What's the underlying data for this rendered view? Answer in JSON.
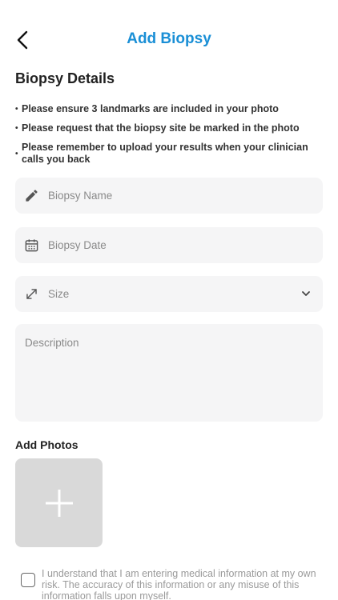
{
  "header": {
    "title": "Add Biopsy",
    "accent_color": "#1a8fd6"
  },
  "section": {
    "title": "Biopsy Details"
  },
  "instructions": [
    "Please ensure 3 landmarks are included in your photo",
    "Please request that the biopsy site be marked in the photo",
    "Please remember to upload your results when your clinician calls you back"
  ],
  "form": {
    "name_placeholder": "Biopsy Name",
    "date_placeholder": "Biopsy Date",
    "size_placeholder": "Size",
    "description_placeholder": "Description",
    "field_background": "#f5f5f6"
  },
  "photos": {
    "title": "Add Photos"
  },
  "consent": {
    "text": "I understand that I am entering medical information at my own risk. The accuracy of this information or any misuse of this information falls upon myself.",
    "checked": false
  },
  "icons": {
    "back": "chevron-left-icon",
    "name": "pencil-icon",
    "date": "calendar-icon",
    "size": "resize-icon",
    "dropdown": "chevron-down-icon",
    "add_photo": "plus-icon"
  }
}
